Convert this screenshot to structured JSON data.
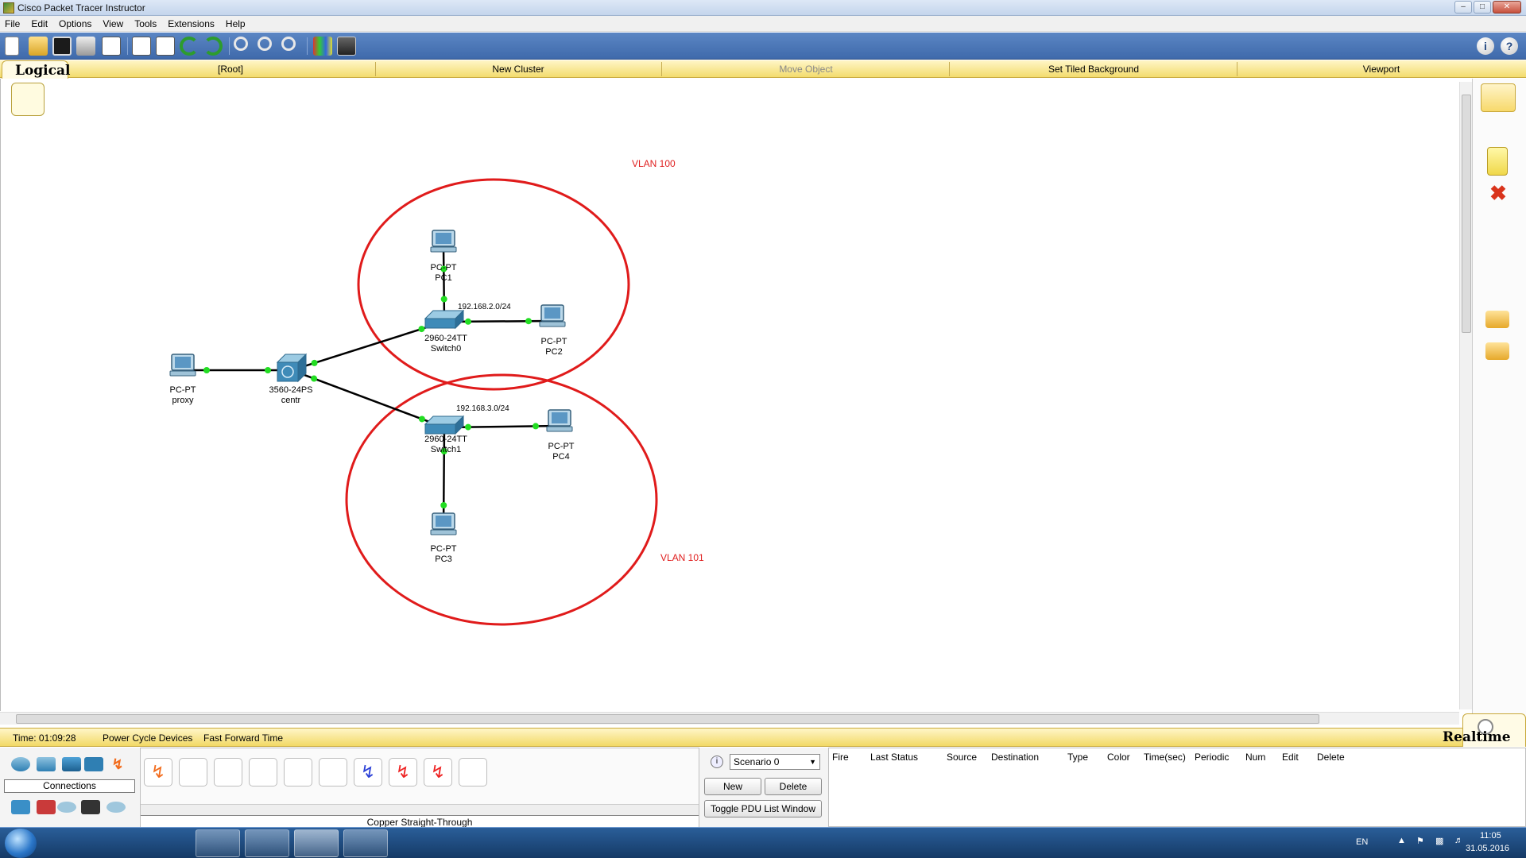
{
  "window": {
    "title": "Cisco Packet Tracer Instructor"
  },
  "menu": [
    "File",
    "Edit",
    "Options",
    "View",
    "Tools",
    "Extensions",
    "Help"
  ],
  "workspace_bar": {
    "logical_tab": "Logical",
    "items": [
      "[Root]",
      "New Cluster",
      "Move Object",
      "Set Tiled Background",
      "Viewport"
    ]
  },
  "topology": {
    "devices": [
      {
        "id": "pc1",
        "model": "PC-PT",
        "name": "PC1",
        "type": "pc"
      },
      {
        "id": "pc2",
        "model": "PC-PT",
        "name": "PC2",
        "type": "pc"
      },
      {
        "id": "proxy",
        "model": "PC-PT",
        "name": "proxy",
        "type": "pc"
      },
      {
        "id": "centr",
        "model": "3560-24PS",
        "name": "centr",
        "type": "multilayer-switch"
      },
      {
        "id": "switch0",
        "model": "2960-24TT",
        "name": "Switch0",
        "type": "switch"
      },
      {
        "id": "switch1",
        "model": "2960-24TT",
        "name": "Switch1",
        "type": "switch"
      },
      {
        "id": "pc4",
        "model": "PC-PT",
        "name": "PC4",
        "type": "pc"
      },
      {
        "id": "pc3",
        "model": "PC-PT",
        "name": "PC3",
        "type": "pc"
      }
    ],
    "links": [
      [
        "proxy",
        "centr"
      ],
      [
        "centr",
        "switch0"
      ],
      [
        "centr",
        "switch1"
      ],
      [
        "switch0",
        "pc1"
      ],
      [
        "switch0",
        "pc2"
      ],
      [
        "switch1",
        "pc4"
      ],
      [
        "switch1",
        "pc3"
      ]
    ],
    "annotations": [
      {
        "id": "vlan100",
        "text": "VLAN 100",
        "color": "#e02020"
      },
      {
        "id": "vlan101",
        "text": "VLAN 101",
        "color": "#e02020"
      },
      {
        "id": "net0",
        "text": "192.168.2.0/24"
      },
      {
        "id": "net1",
        "text": "192.168.3.0/24"
      }
    ],
    "link_color": "#000000",
    "port_up_color": "#22dd22",
    "ellipse_color": "#e01b1b"
  },
  "status": {
    "time": "Time: 01:09:28",
    "power_cycle": "Power Cycle Devices",
    "fast_forward": "Fast Forward Time",
    "mode": "Realtime"
  },
  "device_panel": {
    "category_label": "Connections",
    "selected_cable": "Copper Straight-Through",
    "cables": [
      "automatic",
      "console",
      "copper-straight",
      "copper-cross",
      "fiber",
      "phone",
      "coaxial",
      "serial-dce",
      "serial-dte",
      "octal"
    ]
  },
  "scenario": {
    "selected": "Scenario 0",
    "new_button": "New",
    "delete_button": "Delete",
    "toggle_button": "Toggle PDU List Window"
  },
  "pdu_table": {
    "columns": [
      "Fire",
      "Last Status",
      "Source",
      "Destination",
      "Type",
      "Color",
      "Time(sec)",
      "Periodic",
      "Num",
      "Edit",
      "Delete"
    ]
  },
  "taskbar": {
    "lang": "EN",
    "time": "11:05",
    "date": "31.05.2016"
  }
}
